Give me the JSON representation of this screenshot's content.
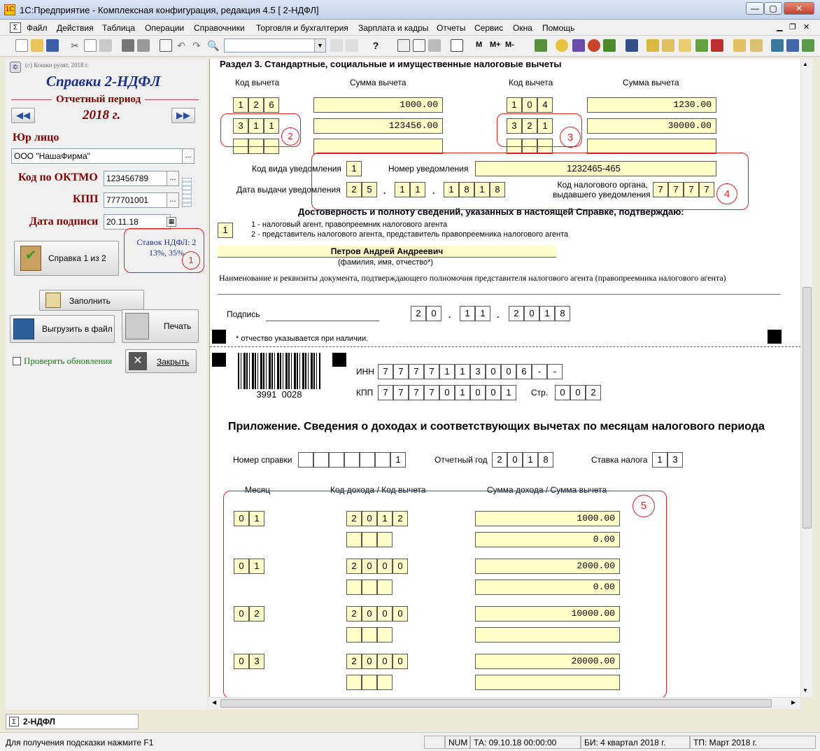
{
  "window": {
    "title": "1С:Предприятие - Комплексная конфигурация, редакция 4.5   [ 2-НДФЛ]",
    "icon": "1c-app-icon",
    "min": "—",
    "max": "▢",
    "close": "✕"
  },
  "menu": [
    "Файл",
    "Действия",
    "Таблица",
    "Операции",
    "Справочники",
    "Торговля и бухгалтерия",
    "Зарплата и кадры",
    "Отчеты",
    "Сервис",
    "Окна",
    "Помощь"
  ],
  "toolbar": {
    "labels": [
      "M",
      "M+",
      "M-"
    ]
  },
  "left": {
    "copyright": "(с) Кошки рулят, 2018 г.",
    "title": "Справки 2-НДФЛ",
    "period_label": "Отчетный период",
    "period_value": "2018 г.",
    "org_label": "Юр лицо",
    "org_value": "ООО \"НашаФирма\"",
    "oktmo_label": "Код по ОКТМО",
    "oktmo_value": "123456789",
    "kpp_label": "КПП",
    "kpp_value": "777701001",
    "date_label": "Дата подписи",
    "date_value": "20.11.18",
    "cert_btn": "Справка 1 из 2",
    "rates_line1": "Ставок НДФЛ: 2",
    "rates_line2": "13%, 35%",
    "fill_btn": "Заполнить",
    "export_btn": "Выгрузить в файл",
    "print_btn": "Печать",
    "updates_chk": "Проверять обновления",
    "close_btn": "Закрыть"
  },
  "form": {
    "section_title": "Раздел 3. Стандартные, социальные и имущественные налоговые вычеты",
    "col_code": "Код вычета",
    "col_sum": "Сумма вычета",
    "deductions_left": [
      {
        "code": [
          "1",
          "2",
          "6"
        ],
        "sum": "1000.00"
      },
      {
        "code": [
          "3",
          "1",
          "1"
        ],
        "sum": "123456.00"
      },
      {
        "code": [
          "",
          "",
          ""
        ],
        "sum": ""
      }
    ],
    "deductions_right": [
      {
        "code": [
          "1",
          "0",
          "4"
        ],
        "sum": "1230.00"
      },
      {
        "code": [
          "3",
          "2",
          "1"
        ],
        "sum": "30000.00"
      },
      {
        "code": [
          "",
          "",
          ""
        ],
        "sum": ""
      }
    ],
    "notice_type_label": "Код вида уведомления",
    "notice_type": "1",
    "notice_no_label": "Номер уведомления",
    "notice_no": "1232465-465",
    "notice_date_label": "Дата выдачи уведомления",
    "notice_date": {
      "d": [
        "2",
        "5"
      ],
      "m": [
        "1",
        "1"
      ],
      "y": [
        "1",
        "8",
        "1",
        "8"
      ]
    },
    "authority_label_1": "Код налогового органа,",
    "authority_label_2": "выдавшего уведомления",
    "authority": [
      "7",
      "7",
      "7",
      "7"
    ],
    "confirm_title": "Достоверность и полноту сведений, указанных в настоящей Справке, подтверждаю:",
    "signer_type": "1",
    "signer_opt1": "1 - налоговый агент, правопреемник налогового агента",
    "signer_opt2": "2 - представитель налогового агента, представитель правопреемника налогового агента",
    "signer_name": "Петров Андрей Андреевич",
    "signer_hint": "(фамилия, имя, отчество*)",
    "doc_label": "Наименование и реквизиты документа, подтверждающего полномочия представителя налогового агента (правопреемника налогового агента)",
    "sign_label": "Подпись",
    "sign_date": {
      "d": [
        "2",
        "0"
      ],
      "m": [
        "1",
        "1"
      ],
      "y": [
        "2",
        "0",
        "1",
        "8"
      ]
    },
    "footnote": "* отчество указывается при наличии.",
    "barcode": "3991  0028",
    "inn_label": "ИНН",
    "inn": [
      "7",
      "7",
      "7",
      "7",
      "1",
      "1",
      "3",
      "0",
      "0",
      "6",
      "-",
      "-"
    ],
    "kpp_label": "КПП",
    "kpp": [
      "7",
      "7",
      "7",
      "7",
      "0",
      "1",
      "0",
      "0",
      "1"
    ],
    "page_label": "Стр.",
    "page": [
      "0",
      "0",
      "2"
    ],
    "app_title": "Приложение. Сведения о доходах и соответствующих вычетах по месяцам налогового периода",
    "cert_no_label": "Номер справки",
    "cert_no": [
      "",
      "",
      "",
      "",
      "",
      "",
      "1"
    ],
    "year_label": "Отчетный год",
    "year": [
      "2",
      "0",
      "1",
      "8"
    ],
    "rate_label": "Ставка налога",
    "rate": [
      "1",
      "3"
    ],
    "hdr_month": "Месяц",
    "hdr_code": "Код дохода / Код вычета",
    "hdr_sum": "Сумма дохода / Сумма вычета",
    "rows": [
      {
        "month": [
          "0",
          "1"
        ],
        "code": [
          "2",
          "0",
          "1",
          "2"
        ],
        "income": "1000.00",
        "deduction": "0.00"
      },
      {
        "month": [
          "0",
          "1"
        ],
        "code": [
          "2",
          "0",
          "0",
          "0"
        ],
        "income": "2000.00",
        "deduction": "0.00"
      },
      {
        "month": [
          "0",
          "2"
        ],
        "code": [
          "2",
          "0",
          "0",
          "0"
        ],
        "income": "10000.00",
        "deduction": ""
      },
      {
        "month": [
          "0",
          "3"
        ],
        "code": [
          "2",
          "0",
          "0",
          "0"
        ],
        "income": "20000.00",
        "deduction": ""
      }
    ],
    "markers": [
      "1",
      "2",
      "3",
      "4",
      "5"
    ]
  },
  "tab": "2-НДФЛ",
  "status": {
    "hint": "Для получения подсказки нажмите F1",
    "num": "NUM",
    "ta": "ТА: 09.10.18  00:00:00",
    "bi": "БИ: 4 квартал 2018 г.",
    "tp": "ТП: Март 2018 г."
  }
}
